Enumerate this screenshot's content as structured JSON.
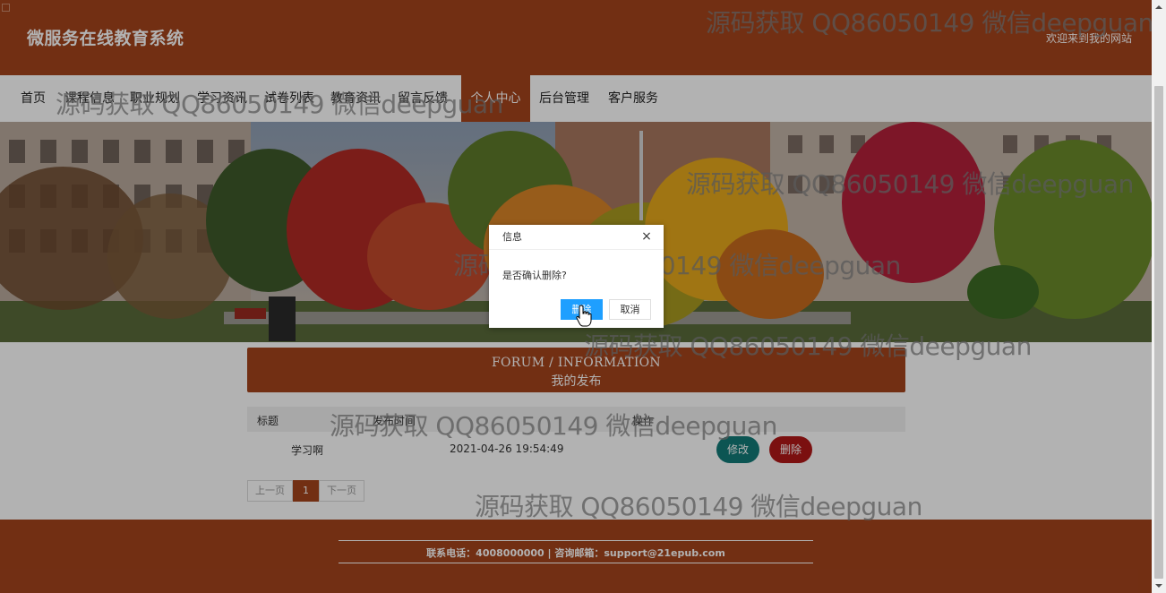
{
  "header": {
    "site_title": "微服务在线教育系统",
    "welcome": "欢迎来到我的网站"
  },
  "nav": {
    "items": [
      {
        "label": "首页"
      },
      {
        "label": "课程信息"
      },
      {
        "label": "职业规划"
      },
      {
        "label": "学习资讯"
      },
      {
        "label": "试卷列表"
      },
      {
        "label": "教育资讯"
      },
      {
        "label": "留言反馈"
      },
      {
        "label": "个人中心"
      },
      {
        "label": "后台管理"
      },
      {
        "label": "客户服务"
      }
    ],
    "active": "个人中心"
  },
  "section": {
    "title_en": "FORUM / INFORMATION",
    "title_cn": "我的发布"
  },
  "table": {
    "columns": [
      "标题",
      "发布时间",
      "操作"
    ],
    "rows": [
      {
        "title": "学习啊",
        "time": "2021-04-26 19:54:49",
        "edit": "修改",
        "delete": "删除"
      }
    ]
  },
  "pager": {
    "prev": "上一页",
    "current": "1",
    "next": "下一页"
  },
  "footer": {
    "contact": "联系电话：4008000000 | 咨询邮箱：support@21epub.com"
  },
  "dialog": {
    "title": "信息",
    "close": "×",
    "message": "是否确认删除?",
    "confirm": "删除",
    "cancel": "取消"
  },
  "watermark": {
    "text": "源码获取 QQ86050149 微信deepguan"
  },
  "colors": {
    "brand": "#a4441c",
    "edit_button": "#127a78",
    "delete_button": "#b01818",
    "dialog_confirm": "#1e9fff"
  }
}
